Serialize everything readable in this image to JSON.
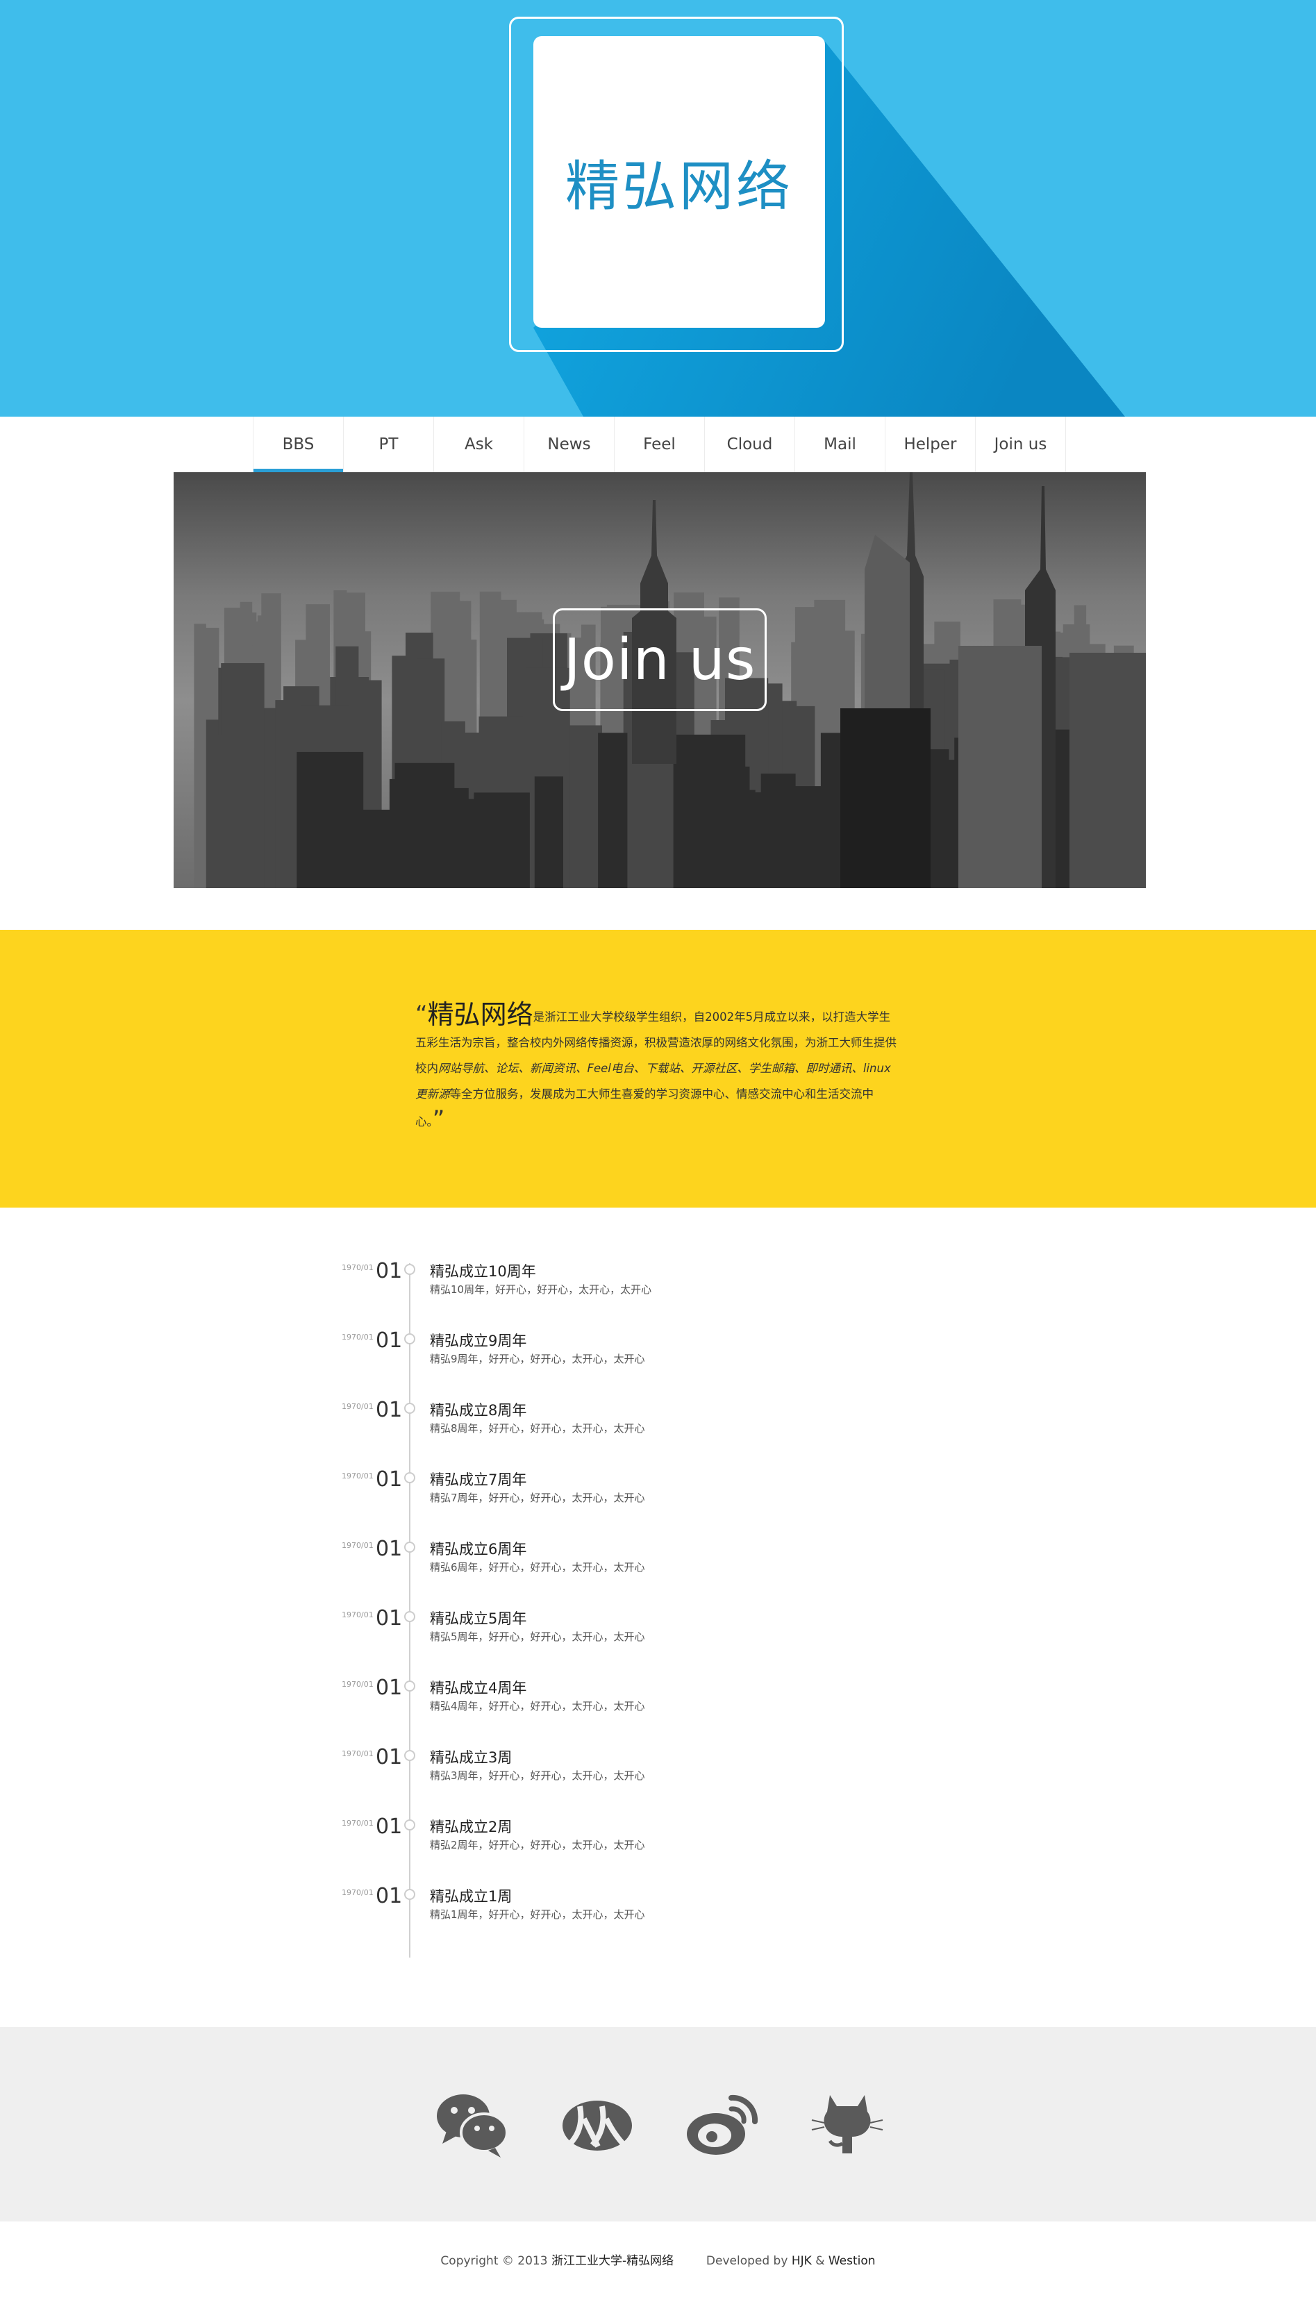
{
  "header": {
    "logo_text": "精弘网络",
    "colors": {
      "background": "#3fbdeb",
      "shadow": "#0b95cf",
      "logo_text": "#1e8fc4"
    }
  },
  "nav": {
    "items": [
      {
        "label": "BBS",
        "active": true
      },
      {
        "label": "PT",
        "active": false
      },
      {
        "label": "Ask",
        "active": false
      },
      {
        "label": "News",
        "active": false
      },
      {
        "label": "Feel",
        "active": false
      },
      {
        "label": "Cloud",
        "active": false
      },
      {
        "label": "Mail",
        "active": false
      },
      {
        "label": "Helper",
        "active": false
      },
      {
        "label": "Join us",
        "active": false
      }
    ],
    "accent": "#2a9fd6"
  },
  "banner": {
    "join_text": "Join us"
  },
  "intro": {
    "open_quote": "“",
    "brand": "精弘网络",
    "text_1": "是浙江工业大学校级学生组织，自2002年5月成立以来，以打造大学生五彩生活为宗旨，整合校内外网络传播资源，积极营造浓厚的网络文化氛围，为浙工大师生提供校内",
    "services": "网站导航、论坛、新闻资讯、Feel电台、下载站、开源社区、学生邮箱、即时通讯、linux更新源",
    "text_2": "等全方位服务，发展成为工大师生喜爱的学习资源中心、情感交流中心和生活交流中心。",
    "close_quote": "”",
    "background": "#fdd41e"
  },
  "timeline": {
    "items": [
      {
        "date": "1970/01",
        "day": "01",
        "title": "精弘成立10周年",
        "desc": "精弘10周年，好开心，好开心，太开心，太开心"
      },
      {
        "date": "1970/01",
        "day": "01",
        "title": "精弘成立9周年",
        "desc": "精弘9周年，好开心，好开心，太开心，太开心"
      },
      {
        "date": "1970/01",
        "day": "01",
        "title": "精弘成立8周年",
        "desc": "精弘8周年，好开心，好开心，太开心，太开心"
      },
      {
        "date": "1970/01",
        "day": "01",
        "title": "精弘成立7周年",
        "desc": "精弘7周年，好开心，好开心，太开心，太开心"
      },
      {
        "date": "1970/01",
        "day": "01",
        "title": "精弘成立6周年",
        "desc": "精弘6周年，好开心，好开心，太开心，太开心"
      },
      {
        "date": "1970/01",
        "day": "01",
        "title": "精弘成立5周年",
        "desc": "精弘5周年，好开心，好开心，太开心，太开心"
      },
      {
        "date": "1970/01",
        "day": "01",
        "title": "精弘成立4周年",
        "desc": "精弘4周年，好开心，好开心，太开心，太开心"
      },
      {
        "date": "1970/01",
        "day": "01",
        "title": "精弘成立3周",
        "desc": "精弘3周年，好开心，好开心，太开心，太开心"
      },
      {
        "date": "1970/01",
        "day": "01",
        "title": "精弘成立2周",
        "desc": "精弘2周年，好开心，好开心，太开心，太开心"
      },
      {
        "date": "1970/01",
        "day": "01",
        "title": "精弘成立1周",
        "desc": "精弘1周年，好开心，好开心，太开心，太开心"
      }
    ]
  },
  "social": {
    "icons": [
      "wechat-icon",
      "renren-icon",
      "weibo-icon",
      "github-icon"
    ],
    "icon_color": "#5a5a5a",
    "background": "#efefef"
  },
  "footer": {
    "copyright_prefix": "Copyright © 2013",
    "org": "浙江工业大学-精弘网络",
    "developed_prefix": "Developed by",
    "dev_1": "HJK",
    "amp": "&",
    "dev_2": "Westion"
  }
}
